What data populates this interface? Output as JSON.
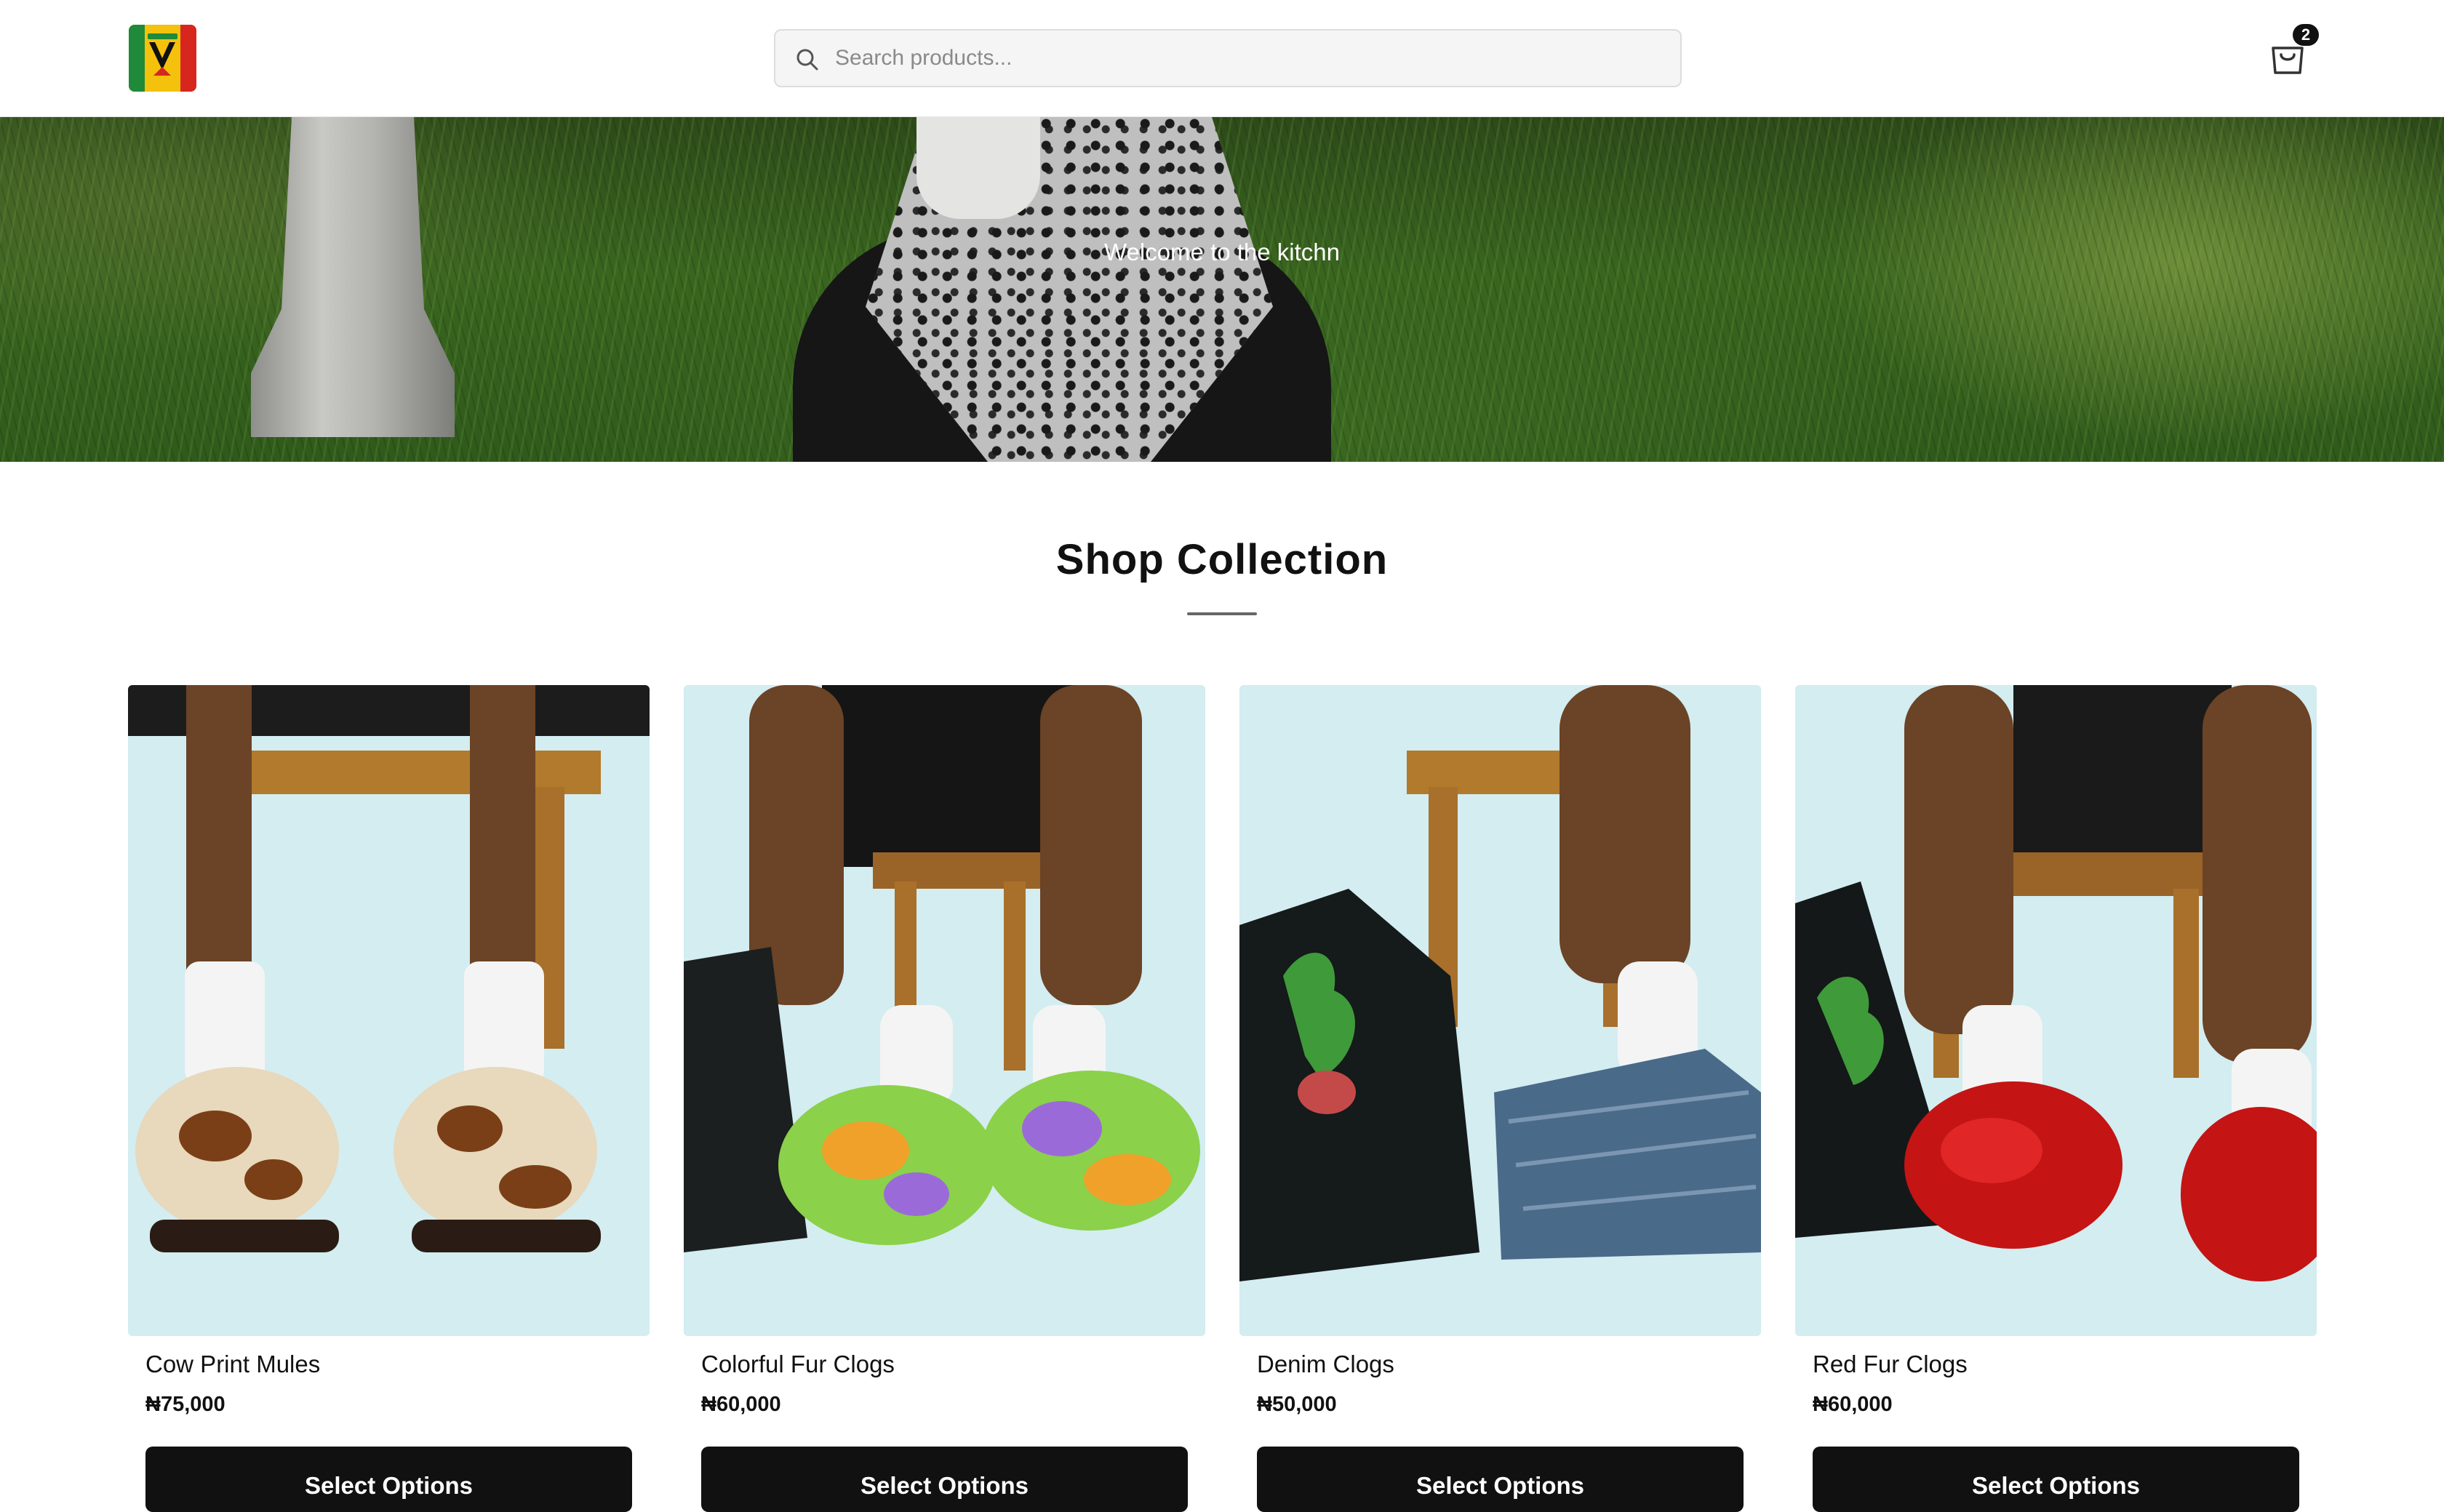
{
  "header": {
    "logo_alt": "Store logo",
    "search": {
      "placeholder": "Search products...",
      "value": ""
    },
    "cart": {
      "count": "2"
    }
  },
  "hero": {
    "text": "Welcome to the kitchn"
  },
  "collection": {
    "title": "Shop Collection",
    "products": [
      {
        "name": "Cow Print Mules",
        "price": "₦75,000",
        "button": "Select Options"
      },
      {
        "name": "Colorful Fur Clogs",
        "price": "₦60,000",
        "button": "Select Options"
      },
      {
        "name": "Denim Clogs",
        "price": "₦50,000",
        "button": "Select Options"
      },
      {
        "name": "Red Fur Clogs",
        "price": "₦60,000",
        "button": "Select Options"
      }
    ]
  },
  "icons": {
    "search": "search-icon",
    "cart": "shopping-bag-icon"
  },
  "colors": {
    "button_bg": "#111111",
    "button_text": "#ffffff",
    "background": "#ffffff",
    "product_backdrop": "#cfeaf0"
  }
}
